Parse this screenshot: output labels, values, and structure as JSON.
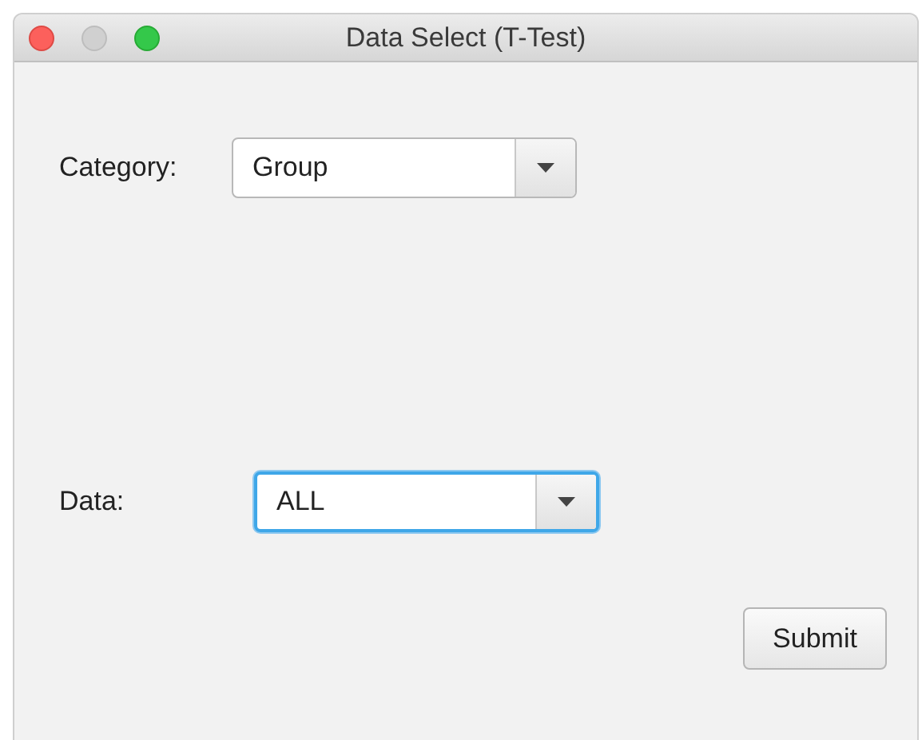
{
  "window": {
    "title": "Data Select (T-Test)"
  },
  "window_controls": [
    {
      "kind": "close",
      "disabled": false
    },
    {
      "kind": "minimize",
      "disabled": true
    },
    {
      "kind": "zoom",
      "disabled": false
    }
  ],
  "fields": [
    {
      "label": "Category:",
      "value": "Group",
      "focused": false
    },
    {
      "label": "Data:",
      "value": "ALL",
      "focused": true
    }
  ],
  "submit_button": {
    "label": "Submit"
  }
}
